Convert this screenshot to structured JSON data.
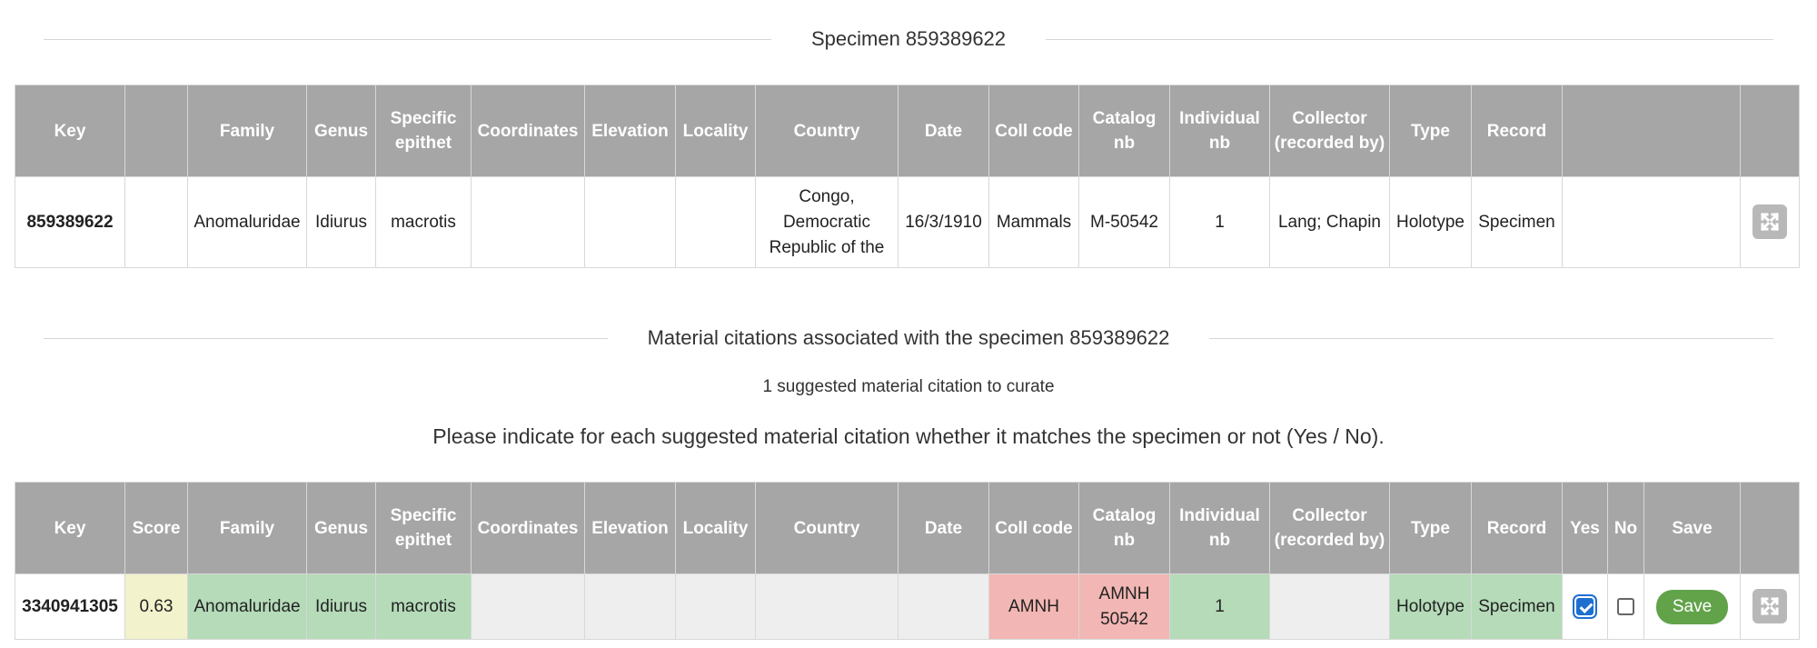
{
  "specimen_section": {
    "title": "Specimen 859389622"
  },
  "columns": {
    "key": "Key",
    "score": "Score",
    "family": "Family",
    "genus": "Genus",
    "specific_epithet": "Specific epithet",
    "coordinates": "Coordinates",
    "elevation": "Elevation",
    "locality": "Locality",
    "country": "Country",
    "date": "Date",
    "coll_code": "Coll code",
    "catalog_nb": "Catalog nb",
    "individual_nb": "Individual nb",
    "collector": "Collector (recorded by)",
    "type": "Type",
    "record": "Record",
    "yes": "Yes",
    "no": "No",
    "save": "Save"
  },
  "specimen": {
    "key": "859389622",
    "family": "Anomaluridae",
    "genus": "Idiurus",
    "specific_epithet": "macrotis",
    "coordinates": "",
    "elevation": "",
    "locality": "",
    "country": "Congo, Democratic Republic of the",
    "date": "16/3/1910",
    "coll_code": "Mammals",
    "catalog_nb": "M-50542",
    "individual_nb": "1",
    "collector": "Lang; Chapin",
    "type": "Holotype",
    "record": "Specimen"
  },
  "citations_section": {
    "title": "Material citations associated with the specimen 859389622",
    "count_text": "1 suggested material citation to curate",
    "instruction": "Please indicate for each suggested material citation whether it matches the specimen or not (Yes / No)."
  },
  "citation": {
    "key": "3340941305",
    "score": "0.63",
    "family": "Anomaluridae",
    "genus": "Idiurus",
    "specific_epithet": "macrotis",
    "coordinates": "",
    "elevation": "",
    "locality": "",
    "country": "",
    "date": "",
    "coll_code": "AMNH",
    "catalog_nb": "AMNH 50542",
    "individual_nb": "1",
    "collector": "",
    "type": "Holotype",
    "record": "Specimen",
    "yes_checked": true,
    "no_checked": false,
    "save_label": "Save"
  },
  "icons": {
    "expand": "expand-arrows-icon"
  },
  "colors": {
    "header_bg": "#a6a6a6",
    "key_link": "#5a9a2c",
    "match": "#b5dbb9",
    "mismatch": "#f2b7b4",
    "score_bg": "#f2f2cc",
    "empty_bg": "#eeeeee",
    "save_button": "#62a34a"
  }
}
